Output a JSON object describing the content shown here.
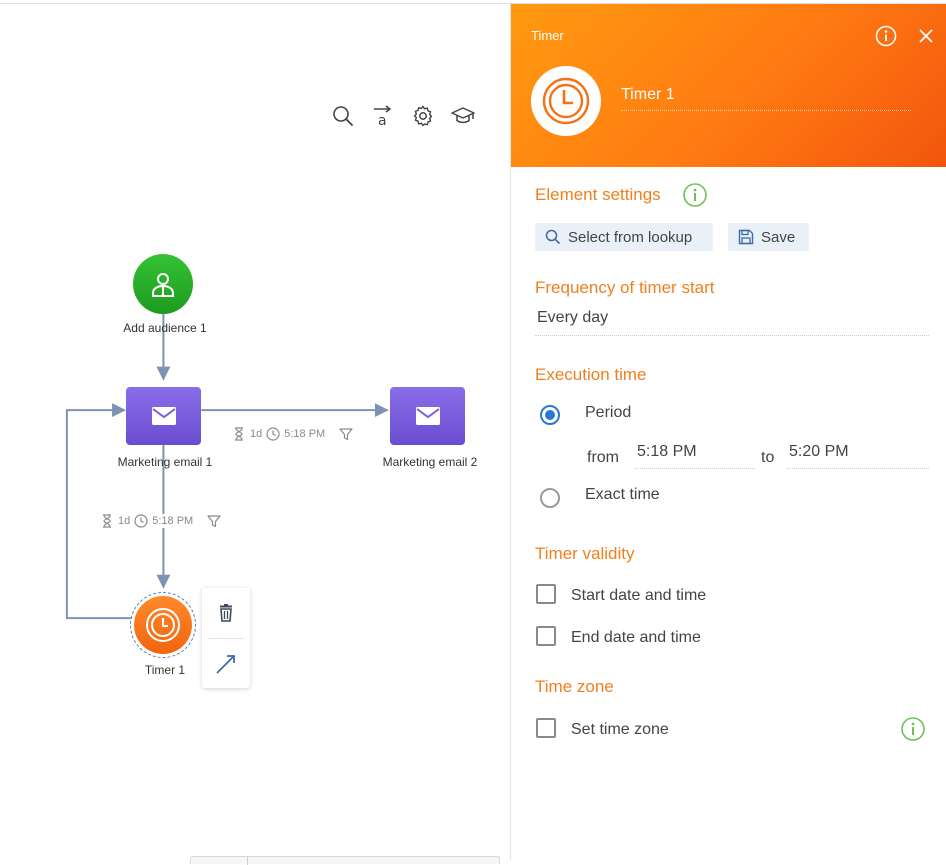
{
  "canvas": {
    "toolbar": {
      "search_icon": "search-icon",
      "translate_icon": "text-arrow-icon",
      "settings_icon": "gear-icon",
      "academy_icon": "graduation-cap-icon"
    },
    "nodes": {
      "audience": {
        "label": "Add audience 1",
        "icon": "user-icon",
        "color": "#2ba52a"
      },
      "email1": {
        "label": "Marketing email 1",
        "icon": "envelope-icon",
        "color": "#7a5de0"
      },
      "email2": {
        "label": "Marketing email 2",
        "icon": "envelope-icon",
        "color": "#7a5de0"
      },
      "timer": {
        "label": "Timer 1",
        "icon": "clock-icon",
        "color": "#f47216"
      }
    },
    "transitions": [
      {
        "delay": "1d",
        "time": "5:18 PM"
      },
      {
        "delay": "1d",
        "time": "5:18 PM"
      }
    ],
    "context_menu": {
      "delete_icon": "trash-icon",
      "connect_icon": "arrow-icon"
    }
  },
  "panel": {
    "kind": "Timer",
    "name": "Timer 1",
    "accent": "#ff7a12",
    "element_settings": {
      "title": "Element settings",
      "lookup_label": "Select from lookup",
      "save_label": "Save"
    },
    "frequency": {
      "title": "Frequency of timer start",
      "value": "Every day"
    },
    "execution": {
      "title": "Execution time",
      "period_label": "Period",
      "from_label": "from",
      "from_value": "5:18 PM",
      "to_label": "to",
      "to_value": "5:20 PM",
      "exact_label": "Exact time",
      "selected": "Period"
    },
    "validity": {
      "title": "Timer validity",
      "start_label": "Start date and time",
      "end_label": "End date and time"
    },
    "timezone": {
      "title": "Time zone",
      "set_label": "Set time zone"
    }
  }
}
